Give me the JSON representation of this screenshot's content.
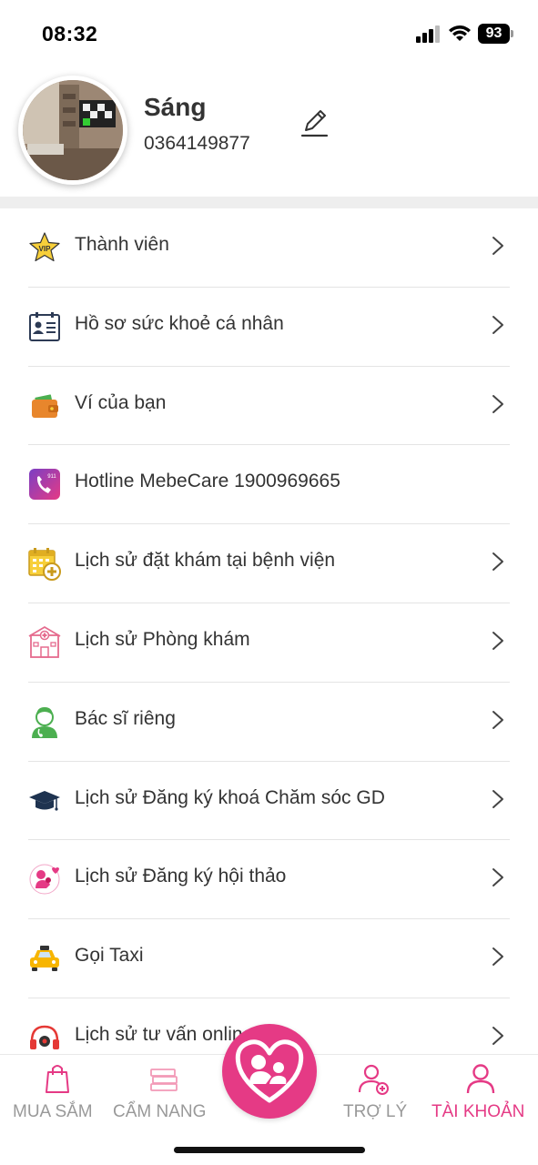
{
  "status": {
    "time": "08:32",
    "battery": "93"
  },
  "profile": {
    "name": "Sáng",
    "phone": "0364149877"
  },
  "menu": [
    {
      "label": "Thành viên",
      "icon": "vip-star-icon",
      "chevron": true
    },
    {
      "label": "Hồ sơ sức khoẻ cá nhân",
      "icon": "health-profile-icon",
      "chevron": true
    },
    {
      "label": "Ví của bạn",
      "icon": "wallet-icon",
      "chevron": true
    },
    {
      "label": "Hotline MebeCare 1900969665",
      "icon": "hotline-phone-icon",
      "chevron": false
    },
    {
      "label": "Lịch sử đặt khám tại bệnh viện",
      "icon": "calendar-plus-icon",
      "chevron": true
    },
    {
      "label": "Lịch sử Phòng khám",
      "icon": "clinic-icon",
      "chevron": true
    },
    {
      "label": "Bác sĩ riêng",
      "icon": "doctor-icon",
      "chevron": true
    },
    {
      "label": "Lịch sử Đăng ký khoá Chăm sóc GD",
      "icon": "graduation-cap-icon",
      "chevron": true
    },
    {
      "label": "Lịch sử Đăng ký hội thảo",
      "icon": "mother-baby-icon",
      "chevron": true
    },
    {
      "label": "Gọi Taxi",
      "icon": "taxi-icon",
      "chevron": true
    },
    {
      "label": "Lịch sử tư vấn online",
      "icon": "headset-icon",
      "chevron": true
    }
  ],
  "nav": {
    "shop": "MUA SẮM",
    "handbook": "CẨM NANG",
    "assistant": "TRỢ LÝ",
    "account": "TÀI KHOẢN"
  },
  "colors": {
    "brand_pink": "#e53a85",
    "inactive": "#999999"
  }
}
